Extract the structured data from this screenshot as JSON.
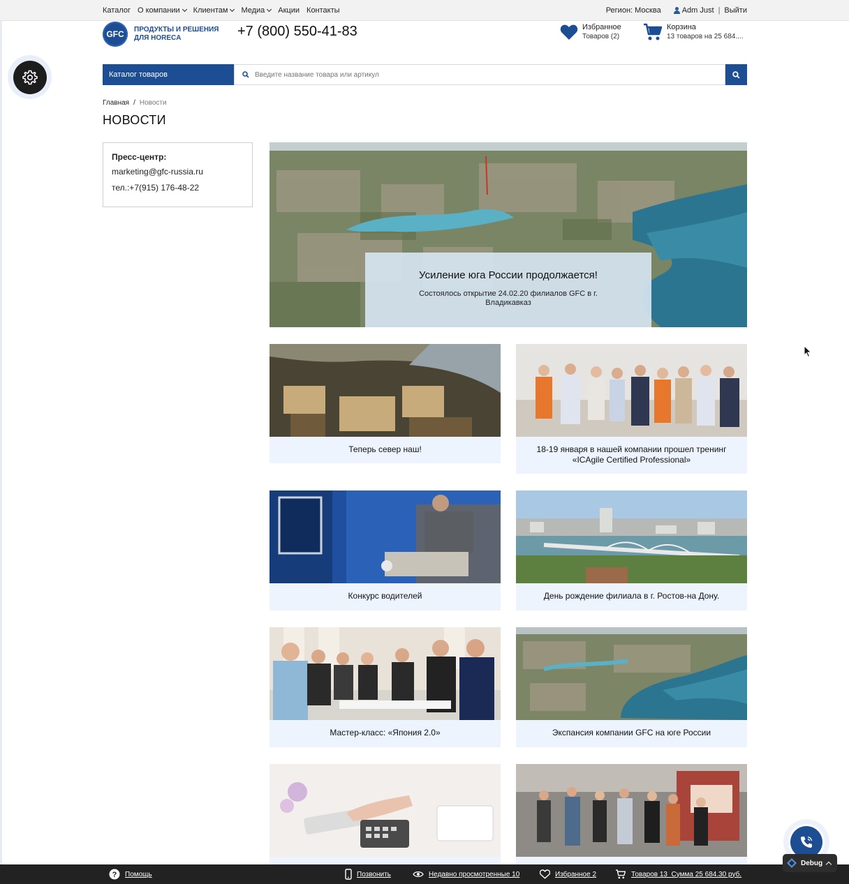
{
  "topbar": {
    "nav": [
      "Каталог",
      "О компании",
      "Клиентам",
      "Медиа",
      "Акции",
      "Контакты"
    ],
    "nav_has_caret": [
      false,
      true,
      true,
      true,
      false,
      false
    ],
    "region": "Регион: Москва",
    "user": "Adm Just",
    "separator": "|",
    "logout": "Выйти"
  },
  "header": {
    "logo_text": "GFC",
    "tagline": "ПРОДУКТЫ И РЕШЕНИЯ ДЛЯ HORECA",
    "phone": "+7 (800) 550-41-83",
    "favorites": {
      "title": "Избранное",
      "sub": "Товаров (2)"
    },
    "cart": {
      "title": "Корзина",
      "sub": "13 товаров на 25 684...."
    }
  },
  "search": {
    "catalog_label": "Каталог товаров",
    "placeholder": "Введите название товара или артикул"
  },
  "breadcrumb": {
    "home": "Главная",
    "sep": "/",
    "current": "Новости"
  },
  "page_title": "НОВОСТИ",
  "press": {
    "heading": "Пресс-центр:",
    "email": "marketing@gfc-russia.ru",
    "phone": "тел.:+7(915) 176-48-22"
  },
  "hero": {
    "title": "Усиление юга России продолжается!",
    "subtitle": "Состоялось открытие 24.02.20 филиалов GFC в г. Владикавказ"
  },
  "news": [
    {
      "title": "Теперь север наш!",
      "image": "aerial-city-river"
    },
    {
      "title": "18-19 января в нашей компании прошел тренинг «ICAgile Certified Professional»",
      "image": "group-photo"
    },
    {
      "title": "Конкурс водителей",
      "image": "truck-driver"
    },
    {
      "title": "День рождение филиала в г. Ростов-на Дону.",
      "image": "bridge-city"
    },
    {
      "title": "Мастер-класс: «Япония 2.0»",
      "image": "cooking-class"
    },
    {
      "title": "Экспансия компании GFC на юге России",
      "image": "coastal-city"
    },
    {
      "title": "",
      "image": "calculator"
    },
    {
      "title": "",
      "image": "exhibition"
    }
  ],
  "bottombar": {
    "help": "Помощь",
    "call": "Позвонить",
    "recent": "Недавно просмотренные 10",
    "favorites": "Избранное 2",
    "cart": "Товаров 13  Сумма 25 684.30 руб."
  },
  "debug_label": "Debug",
  "colors": {
    "brand": "#1d4e94",
    "card_bg": "#eef4fd",
    "bottom_bar": "#222222"
  }
}
